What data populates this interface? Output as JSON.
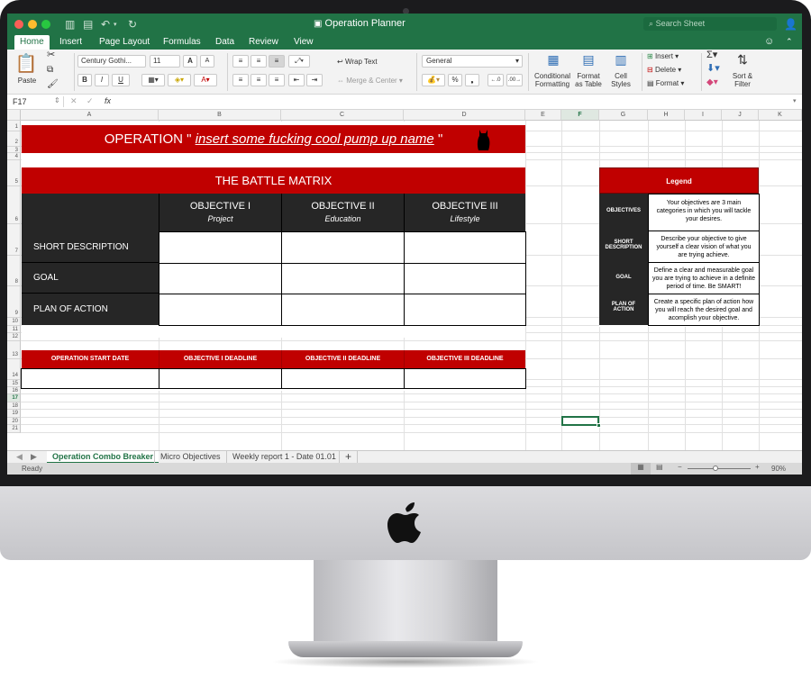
{
  "window": {
    "title": "Operation Planner",
    "search_placeholder": "Search Sheet"
  },
  "ribbon_tabs": [
    "Home",
    "Insert",
    "Page Layout",
    "Formulas",
    "Data",
    "Review",
    "View"
  ],
  "ribbon": {
    "paste": "Paste",
    "font_name": "Century Gothi...",
    "font_size": "11",
    "wrap_text": "Wrap Text",
    "merge_center": "Merge & Center",
    "number_format": "General",
    "conditional_formatting": "Conditional\nFormatting",
    "format_as_table": "Format\nas Table",
    "cell_styles": "Cell\nStyles",
    "insert": "Insert",
    "delete": "Delete",
    "format": "Format",
    "sort_filter": "Sort &\nFilter",
    "bold": "B",
    "italic": "I",
    "underline": "U",
    "percent": "%",
    "font_grow": "A",
    "font_shrink": "A",
    "fx": "fx"
  },
  "formula_bar": {
    "name_box": "F17",
    "formula": ""
  },
  "columns": [
    "A",
    "B",
    "C",
    "D",
    "E",
    "F",
    "G",
    "H",
    "I",
    "J",
    "K"
  ],
  "rows": [
    "1",
    "2",
    "3",
    "4",
    "5",
    "6",
    "7",
    "8",
    "9",
    "10",
    "11",
    "12",
    "13",
    "14",
    "15",
    "16",
    "17",
    "18",
    "19",
    "20",
    "21"
  ],
  "sheet": {
    "operation_prefix": "OPERATION \"",
    "operation_name": "insert some fucking cool pump up name",
    "operation_suffix": "\"",
    "battle_matrix": "THE BATTLE MATRIX",
    "objectives": [
      {
        "title": "OBJECTIVE I",
        "subtitle": "Project"
      },
      {
        "title": "OBJECTIVE II",
        "subtitle": "Education"
      },
      {
        "title": "OBJECTIVE III",
        "subtitle": "Lifestyle"
      }
    ],
    "row_labels": [
      "SHORT DESCRIPTION",
      "GOAL",
      "PLAN OF ACTION"
    ],
    "dates": [
      "OPERATION START DATE",
      "OBJECTIVE I DEADLINE",
      "OBJECTIVE II DEADLINE",
      "OBJECTIVE III DEADLINE"
    ]
  },
  "legend": {
    "title": "Legend",
    "items": [
      {
        "term": "OBJECTIVES",
        "text": "Your objectives are 3 main categories in which you will tackle your desires."
      },
      {
        "term": "SHORT DESCRIPTION",
        "text": "Describe your objective to give yourself a clear vision of what you are trying achieve."
      },
      {
        "term": "GOAL",
        "text": "Define a clear and measurable goal you are trying to achieve in a definite period of time. Be SMART!"
      },
      {
        "term": "PLAN OF ACTION",
        "text": "Create a specific plan of action how you will reach the desired goal and acomplish your objective."
      }
    ]
  },
  "sheet_tabs": [
    "Operation Combo Breaker",
    "Micro Objectives",
    "Weekly report 1 - Date 01.01"
  ],
  "add_sheet": "+",
  "status": {
    "text": "Ready",
    "zoom": "90%"
  },
  "colors": {
    "excel_green": "#217346",
    "accent_red": "#c00000",
    "dark": "#262626"
  },
  "icons": [
    "close-icon",
    "minimize-icon",
    "zoom-icon",
    "save-icon",
    "undo-icon",
    "redo-icon",
    "search-icon",
    "share-icon",
    "smiley-icon",
    "apple-logo-icon"
  ]
}
